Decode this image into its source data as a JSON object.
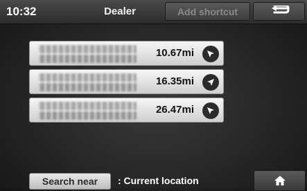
{
  "header": {
    "time": "10:32",
    "title": "Dealer",
    "shortcut_label": "Add shortcut",
    "back_icon": "back-arrow-icon"
  },
  "results": [
    {
      "distance": "10.67mi",
      "direction_icon": "direction-arrow-icon",
      "direction": "upper-left"
    },
    {
      "distance": "16.35mi",
      "direction_icon": "direction-arrow-icon",
      "direction": "upper-right"
    },
    {
      "distance": "26.47mi",
      "direction_icon": "direction-arrow-icon",
      "direction": "upper-left"
    }
  ],
  "footer": {
    "search_label": "Search near",
    "location_text": ": Current location",
    "home_icon": "home-icon"
  }
}
